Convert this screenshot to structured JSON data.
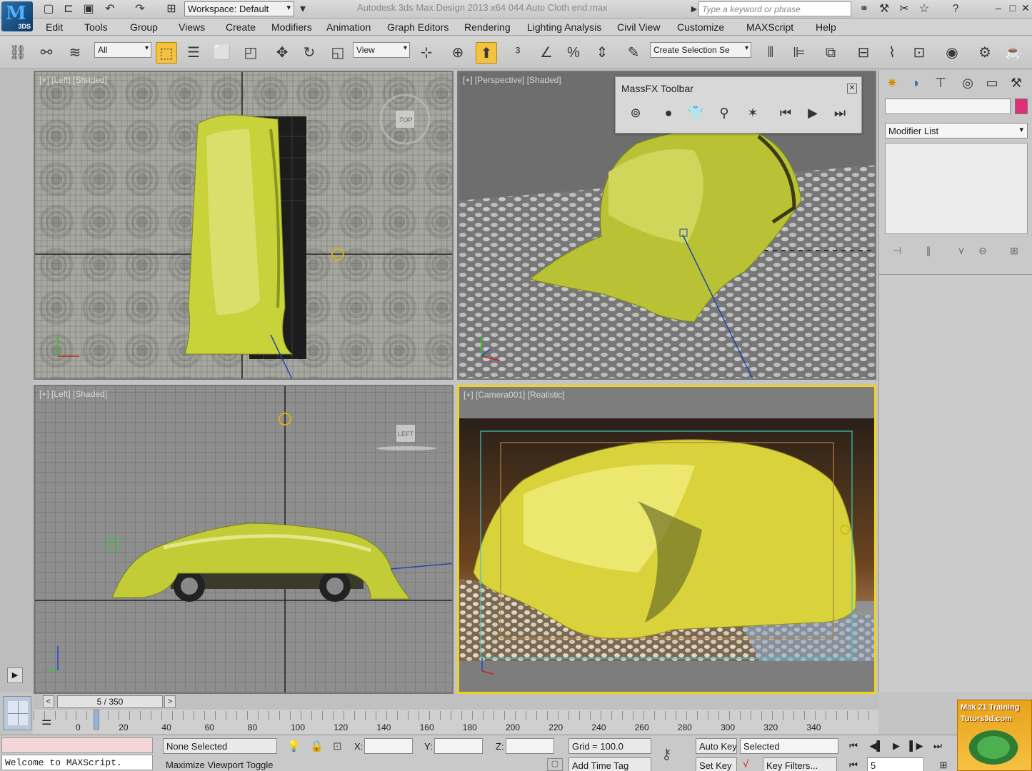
{
  "title_bar": {
    "app_title": "Autodesk 3ds Max Design 2013 x64     044 Auto Cloth end.max",
    "workspace": "Workspace: Default",
    "search_placeholder": "Type a keyword or phrase",
    "logo_text": "3DS"
  },
  "menu": [
    "Edit",
    "Tools",
    "Group",
    "Views",
    "Create",
    "Modifiers",
    "Animation",
    "Graph Editors",
    "Rendering",
    "Lighting Analysis",
    "Civil View",
    "Customize",
    "MAXScript",
    "Help"
  ],
  "main_toolbar": {
    "selection_filter": "All",
    "ref_coord": "View",
    "selection_set": "Create Selection Se"
  },
  "viewports": {
    "top": {
      "label": "[+] [Left] [Shaded]",
      "viewcube": "TOP"
    },
    "perspective": {
      "label": "[+] [Perspective] [Shaded]"
    },
    "left": {
      "label": "[+] [Left] [Shaded]",
      "viewcube": "LEFT"
    },
    "camera": {
      "label": "[+] [Camera001] [Realistic]"
    }
  },
  "massfx": {
    "title": "MassFX Toolbar"
  },
  "command_panel": {
    "modifier_list": "Modifier List",
    "swatch_color": "#e0307a"
  },
  "time_slider": {
    "frame_display": "5 / 350",
    "current_frame": 5,
    "total_frames": 350,
    "ticks": [
      "0",
      "20",
      "40",
      "60",
      "80",
      "100",
      "120",
      "140",
      "160",
      "180",
      "200",
      "220",
      "240",
      "260",
      "280",
      "300",
      "320",
      "340"
    ]
  },
  "status_bar": {
    "maxscript_text": "Welcome to MAXScript.",
    "selection_status": "None Selected",
    "prompt": "Maximize Viewport Toggle",
    "x_label": "X:",
    "y_label": "Y:",
    "z_label": "Z:",
    "grid": "Grid = 100.0",
    "add_time_tag": "Add Time Tag",
    "auto_key": "Auto Key",
    "set_key": "Set Key",
    "key_mode": "Selected",
    "key_filters": "Key Filters...",
    "frame_field": "5"
  },
  "watermark": {
    "line1": "Mak 21 Training",
    "line2": "Tutors3d.com"
  },
  "colors": {
    "active_viewport_border": "#f0d31a",
    "cloth": "#c8d23a",
    "accent_active_tool": "#f4c23e"
  }
}
